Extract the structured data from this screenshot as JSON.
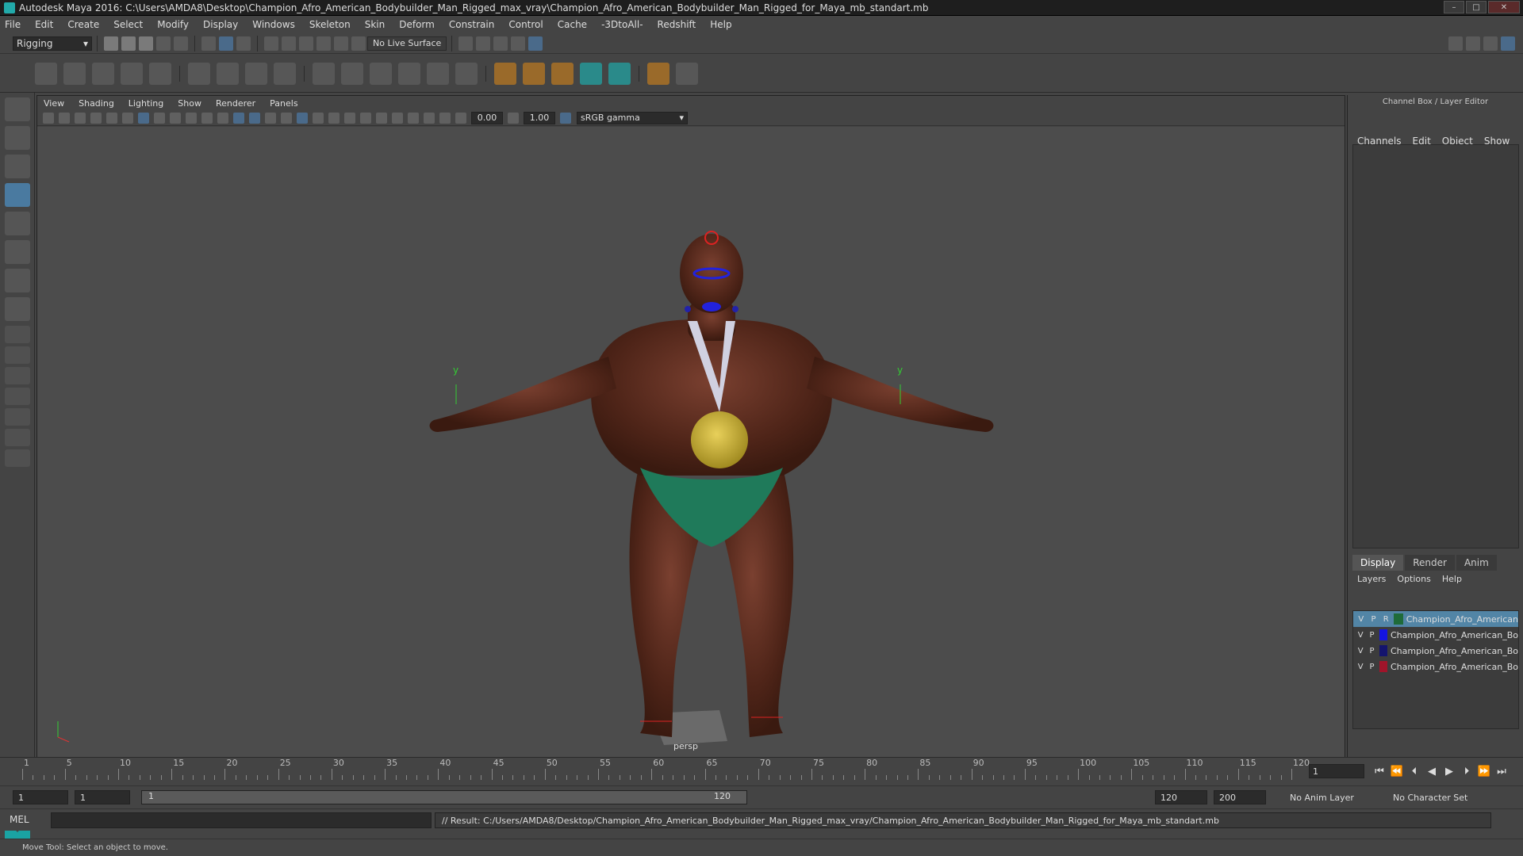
{
  "window": {
    "title": "Autodesk Maya 2016: C:\\Users\\AMDA8\\Desktop\\Champion_Afro_American_Bodybuilder_Man_Rigged_max_vray\\Champion_Afro_American_Bodybuilder_Man_Rigged_for_Maya_mb_standart.mb"
  },
  "menubar": [
    "File",
    "Edit",
    "Create",
    "Select",
    "Modify",
    "Display",
    "Windows",
    "Skeleton",
    "Skin",
    "Deform",
    "Constrain",
    "Control",
    "Cache",
    "-3DtoAll-",
    "Redshift",
    "Help"
  ],
  "status": {
    "mode": "Rigging",
    "live_surface": "No Live Surface"
  },
  "viewport": {
    "menu": [
      "View",
      "Shading",
      "Lighting",
      "Show",
      "Renderer",
      "Panels"
    ],
    "exposure": "0.00",
    "gamma_value": "1.00",
    "color_space": "sRGB gamma",
    "camera": "persp",
    "axis_y": "y",
    "axis_z": "z"
  },
  "channel_box": {
    "title": "Channel Box / Layer Editor",
    "menu": [
      "Channels",
      "Edit",
      "Object",
      "Show"
    ]
  },
  "layer_editor": {
    "tabs": [
      "Display",
      "Render",
      "Anim"
    ],
    "menu": [
      "Layers",
      "Options",
      "Help"
    ],
    "layers": [
      {
        "v": "V",
        "p": "P",
        "r": "R",
        "name": "Champion_Afro_American",
        "color": "#1f6b3a",
        "selected": true
      },
      {
        "v": "V",
        "p": "P",
        "r": "",
        "name": "Champion_Afro_American_Bo",
        "color": "#1414e0",
        "selected": false
      },
      {
        "v": "V",
        "p": "P",
        "r": "",
        "name": "Champion_Afro_American_Bo",
        "color": "#14146e",
        "selected": false
      },
      {
        "v": "V",
        "p": "P",
        "r": "",
        "name": "Champion_Afro_American_Bo",
        "color": "#a0142a",
        "selected": false
      }
    ]
  },
  "timeline": {
    "labels": [
      "1",
      "5",
      "10",
      "15",
      "20",
      "25",
      "30",
      "35",
      "40",
      "45",
      "50",
      "55",
      "60",
      "65",
      "70",
      "75",
      "80",
      "85",
      "90",
      "95",
      "100",
      "105",
      "110",
      "115",
      "120"
    ],
    "current_frame": "1"
  },
  "range": {
    "start": "1",
    "playback_start": "1",
    "slider_start": "1",
    "slider_end": "120",
    "playback_end": "120",
    "end": "200",
    "anim_layer": "No Anim Layer",
    "character_set": "No Character Set"
  },
  "command": {
    "lang": "MEL",
    "result": "// Result: C:/Users/AMDA8/Desktop/Champion_Afro_American_Bodybuilder_Man_Rigged_max_vray/Champion_Afro_American_Bodybuilder_Man_Rigged_for_Maya_mb_standart.mb"
  },
  "help_line": "Move Tool: Select an object to move."
}
